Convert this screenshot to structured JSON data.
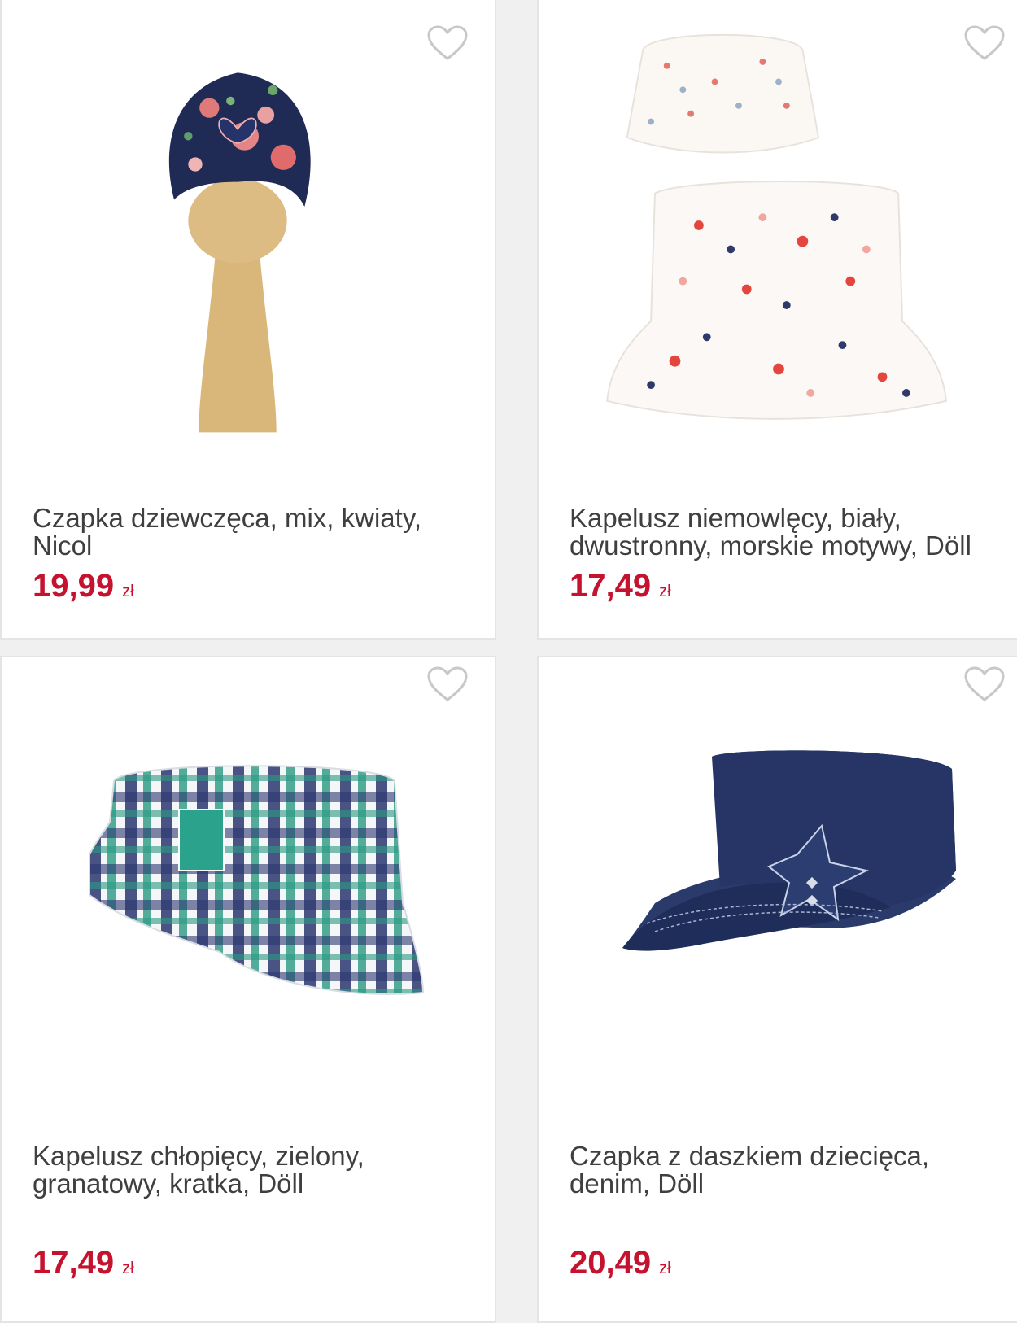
{
  "products": [
    {
      "title": "Czapka dziewczęca, mix, kwiaty, Nicol",
      "price": "19,99",
      "currency": "zł"
    },
    {
      "title": "Kapelusz niemowlęcy, biały, dwustronny, morskie motywy, Döll",
      "price": "17,49",
      "currency": "zł"
    },
    {
      "title": "Kapelusz chłopięcy, zielony, granatowy, kratka, Döll",
      "price": "17,49",
      "currency": "zł"
    },
    {
      "title": "Czapka z daszkiem dziecięca, denim, Döll",
      "price": "20,49",
      "currency": "zł"
    }
  ],
  "colors": {
    "price": "#c4122f",
    "text": "#3f3f3f",
    "heart": "#c8c8c8"
  },
  "icons": {
    "favorite": "heart-outline-icon"
  }
}
